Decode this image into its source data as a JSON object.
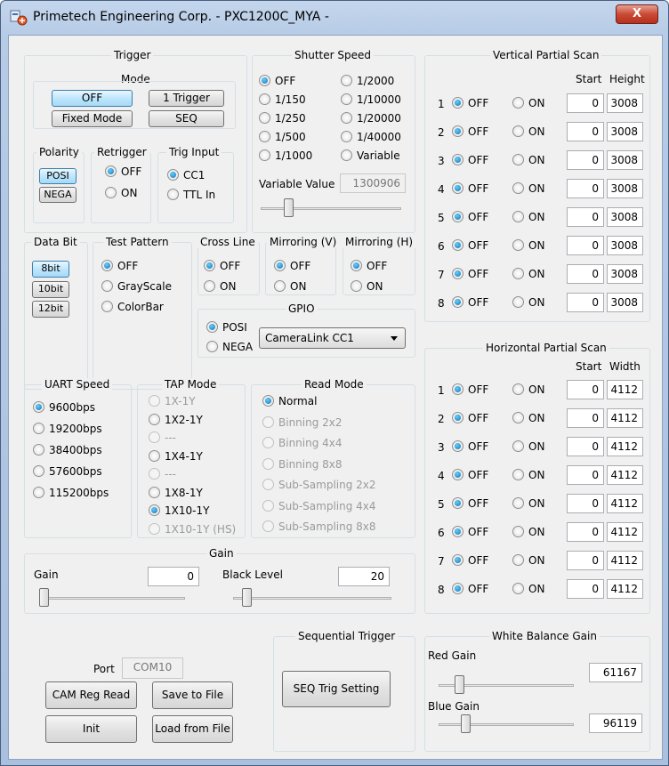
{
  "window": {
    "title": "Primetech Engineering Corp. - PXC1200C_MYA -",
    "close": "X"
  },
  "trigger": {
    "group": "Trigger",
    "mode_label": "Mode",
    "buttons": [
      "OFF",
      "1 Trigger",
      "Fixed Mode",
      "SEQ"
    ],
    "polarity": {
      "label": "Polarity",
      "options": [
        "POSI",
        "NEGA"
      ]
    },
    "retrigger": {
      "label": "Retrigger",
      "options": [
        "OFF",
        "ON"
      ],
      "selected": "OFF"
    },
    "trig_input": {
      "label": "Trig Input",
      "options": [
        "CC1",
        "TTL In"
      ],
      "selected": "CC1"
    }
  },
  "shutter": {
    "group": "Shutter Speed",
    "col1": [
      "OFF",
      "1/150",
      "1/250",
      "1/500",
      "1/1000"
    ],
    "col2": [
      "1/2000",
      "1/10000",
      "1/20000",
      "1/40000",
      "Variable"
    ],
    "selected": "OFF",
    "variable_label": "Variable Value",
    "variable_value": "1300906",
    "slider_level": 0.18
  },
  "vscan": {
    "group": "Vertical Partial Scan",
    "col_start": "Start",
    "col_height": "Height",
    "rows": [
      {
        "n": "1",
        "off": "OFF",
        "on": "ON",
        "start": "0",
        "size": "3008"
      },
      {
        "n": "2",
        "off": "OFF",
        "on": "ON",
        "start": "0",
        "size": "3008"
      },
      {
        "n": "3",
        "off": "OFF",
        "on": "ON",
        "start": "0",
        "size": "3008"
      },
      {
        "n": "4",
        "off": "OFF",
        "on": "ON",
        "start": "0",
        "size": "3008"
      },
      {
        "n": "5",
        "off": "OFF",
        "on": "ON",
        "start": "0",
        "size": "3008"
      },
      {
        "n": "6",
        "off": "OFF",
        "on": "ON",
        "start": "0",
        "size": "3008"
      },
      {
        "n": "7",
        "off": "OFF",
        "on": "ON",
        "start": "0",
        "size": "3008"
      },
      {
        "n": "8",
        "off": "OFF",
        "on": "ON",
        "start": "0",
        "size": "3008"
      }
    ]
  },
  "hscan": {
    "group": "Horizontal Partial Scan",
    "col_start": "Start",
    "col_width": "Width",
    "rows": [
      {
        "n": "1",
        "off": "OFF",
        "on": "ON",
        "start": "0",
        "size": "4112"
      },
      {
        "n": "2",
        "off": "OFF",
        "on": "ON",
        "start": "0",
        "size": "4112"
      },
      {
        "n": "3",
        "off": "OFF",
        "on": "ON",
        "start": "0",
        "size": "4112"
      },
      {
        "n": "4",
        "off": "OFF",
        "on": "ON",
        "start": "0",
        "size": "4112"
      },
      {
        "n": "5",
        "off": "OFF",
        "on": "ON",
        "start": "0",
        "size": "4112"
      },
      {
        "n": "6",
        "off": "OFF",
        "on": "ON",
        "start": "0",
        "size": "4112"
      },
      {
        "n": "7",
        "off": "OFF",
        "on": "ON",
        "start": "0",
        "size": "4112"
      },
      {
        "n": "8",
        "off": "OFF",
        "on": "ON",
        "start": "0",
        "size": "4112"
      }
    ]
  },
  "databit": {
    "group": "Data Bit",
    "options": [
      "8bit",
      "10bit",
      "12bit"
    ]
  },
  "test_pattern": {
    "group": "Test Pattern",
    "options": [
      "OFF",
      "GrayScale",
      "ColorBar"
    ],
    "selected": "OFF"
  },
  "cross_line": {
    "group": "Cross Line",
    "options": [
      "OFF",
      "ON"
    ],
    "selected": "OFF"
  },
  "mirror_v": {
    "group": "Mirroring (V)",
    "options": [
      "OFF",
      "ON"
    ],
    "selected": "OFF"
  },
  "mirror_h": {
    "group": "Mirroring (H)",
    "options": [
      "OFF",
      "ON"
    ],
    "selected": "OFF"
  },
  "gpio": {
    "group": "GPIO",
    "options": [
      "POSI",
      "NEGA"
    ],
    "selected": "POSI",
    "select_value": "CameraLink CC1"
  },
  "uart": {
    "group": "UART Speed",
    "options": [
      "9600bps",
      "19200bps",
      "38400bps",
      "57600bps",
      "115200bps"
    ],
    "selected": "9600bps"
  },
  "tap": {
    "group": "TAP Mode",
    "options": [
      "1X-1Y",
      "1X2-1Y",
      "---",
      "1X4-1Y",
      "---",
      "1X8-1Y",
      "1X10-1Y",
      "1X10-1Y (HS)"
    ],
    "selected": "1X10-1Y"
  },
  "read_mode": {
    "group": "Read Mode",
    "options": [
      "Normal",
      "Binning 2x2",
      "Binning 4x4",
      "Binning 8x8",
      "Sub-Sampling 2x2",
      "Sub-Sampling 4x4",
      "Sub-Sampling 8x8"
    ],
    "selected": "Normal"
  },
  "gain": {
    "group": "Gain",
    "gain_label": "Gain",
    "gain_value": "0",
    "black_label": "Black Level",
    "black_value": "20",
    "gain_level": 0.0,
    "black_level_fraction": 0.06
  },
  "port": {
    "label": "Port",
    "value": "COM10"
  },
  "buttons": {
    "cam_reg_read": "CAM Reg Read",
    "save_to_file": "Save to File",
    "init": "Init",
    "load_from_file": "Load from File"
  },
  "seq_trigger": {
    "group": "Sequential Trigger",
    "button": "SEQ Trig Setting"
  },
  "wb": {
    "group": "White Balance Gain",
    "red_label": "Red Gain",
    "red_value": "61167",
    "blue_label": "Blue Gain",
    "blue_value": "96119",
    "red_level": 0.13,
    "blue_level": 0.18
  }
}
